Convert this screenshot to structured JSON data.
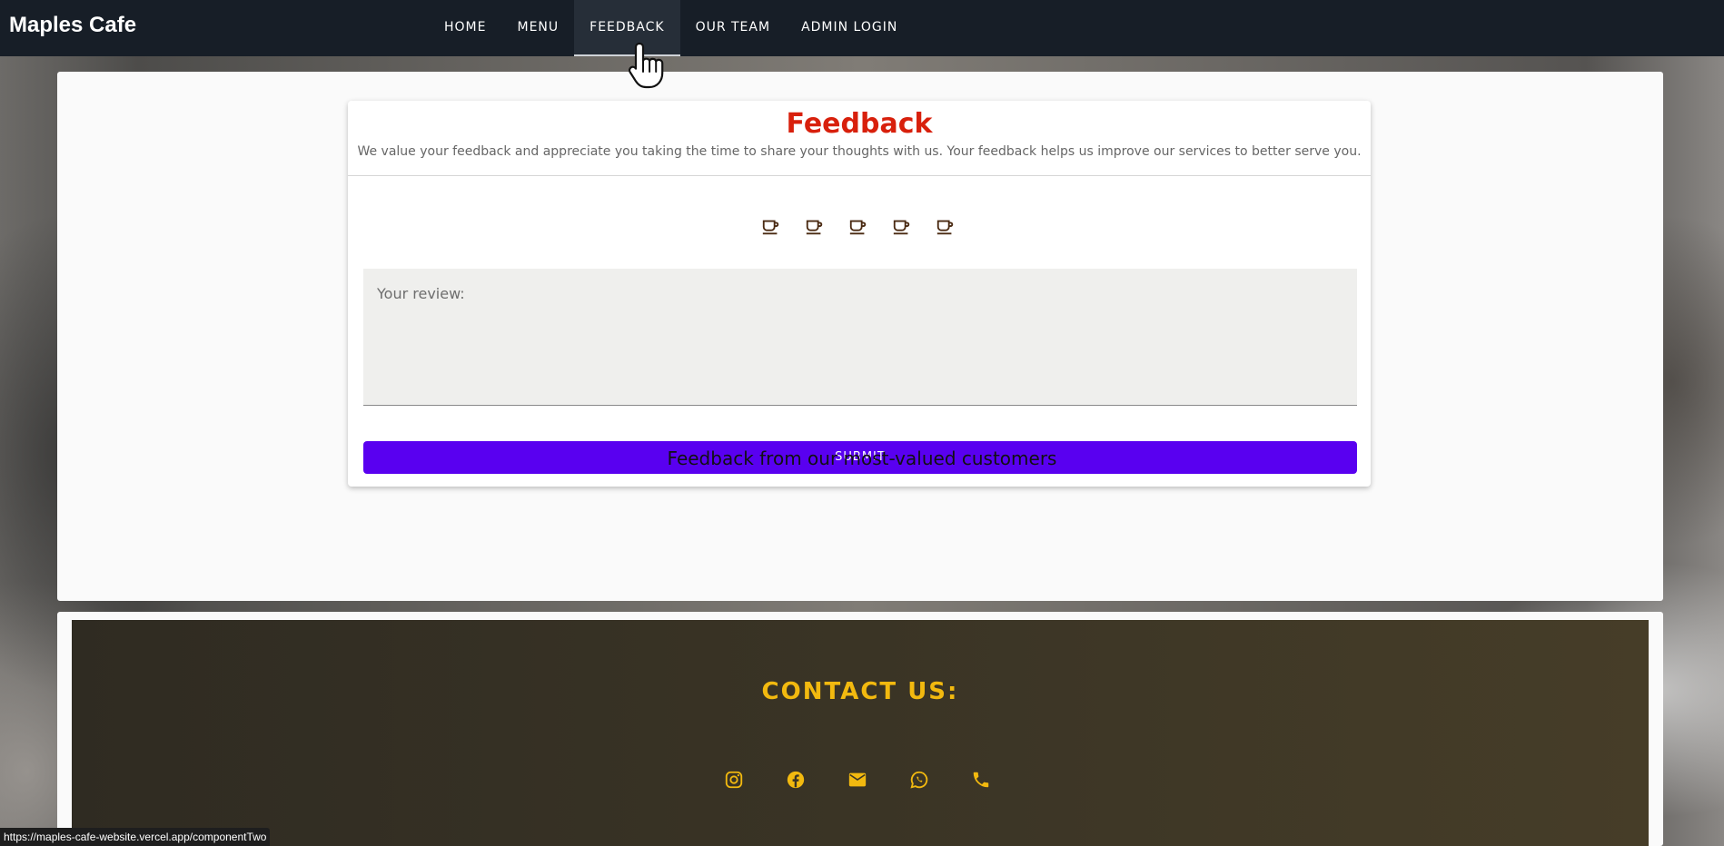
{
  "nav": {
    "brand": "Maples Cafe",
    "links": [
      "HOME",
      "MENU",
      "FEEDBACK",
      "OUR TEAM",
      "ADMIN LOGIN"
    ],
    "active": "FEEDBACK"
  },
  "feedback": {
    "title": "Feedback",
    "subtitle": "We value your feedback and appreciate you taking the time to share your thoughts with us. Your feedback helps us improve our services to better serve you.",
    "rating_icon": "coffee-cup-icon",
    "rating_max": 5,
    "rating_value": 0,
    "review_placeholder": "Your review:",
    "submit_label": "SUBMIT"
  },
  "customers_heading": "Feedback from our most-valued customers",
  "contact": {
    "title": "CONTACT US:",
    "icons": [
      "instagram-icon",
      "facebook-icon",
      "email-icon",
      "whatsapp-icon",
      "phone-icon"
    ]
  },
  "status_url": "https://maples-cafe-website.vercel.app/componentTwo",
  "colors": {
    "navbar": "#171e27",
    "title_red": "#d8200c",
    "submit": "#5900f0",
    "contact_accent": "#f2b90f",
    "cup": "#4a2a12"
  }
}
